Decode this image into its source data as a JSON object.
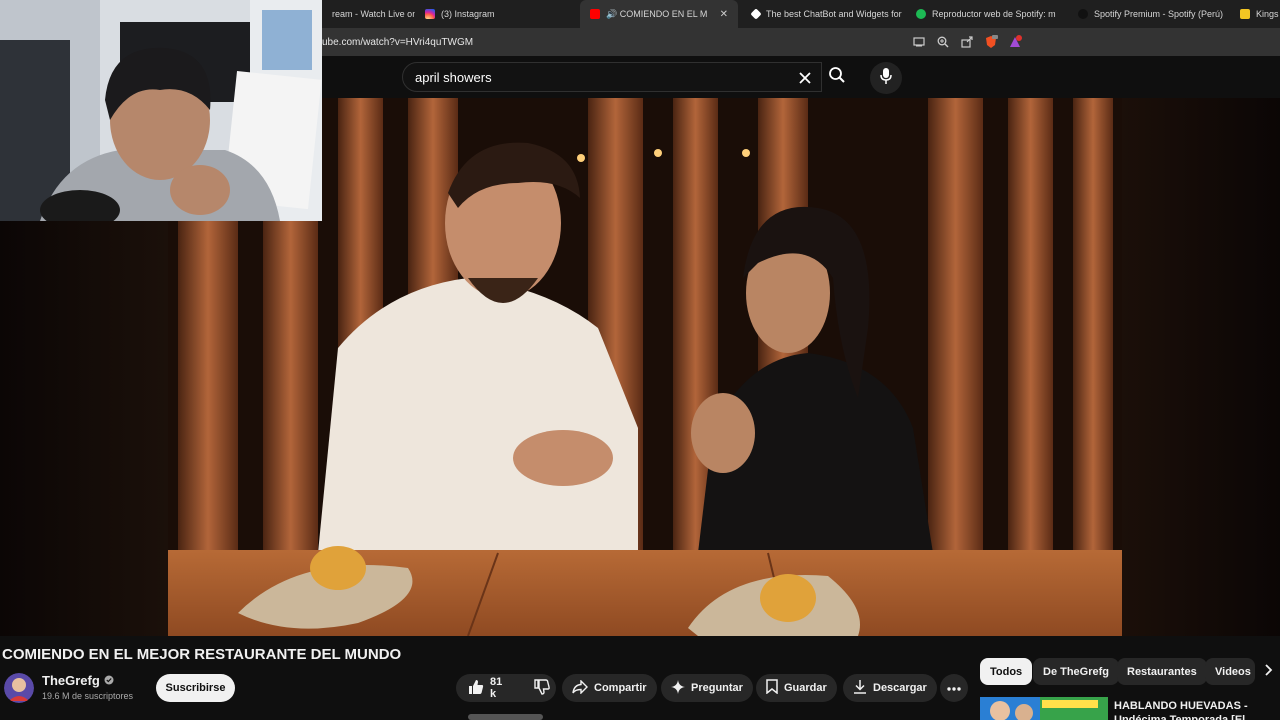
{
  "browser": {
    "tabs": [
      {
        "label": "ream - Watch Live on",
        "favicon_color": "#1f1f1f",
        "active": false
      },
      {
        "label": "(3) Instagram",
        "favicon_color": "#d62976",
        "active": false
      },
      {
        "label": "🔊 COMIENDO EN EL MEJOR R",
        "favicon_color": "#ff0000",
        "active": true
      },
      {
        "label": "The best ChatBot and Widgets for",
        "favicon_color": "#ffffff",
        "active": false
      },
      {
        "label": "Reproductor web de Spotify: músic",
        "favicon_color": "#1db954",
        "active": false
      },
      {
        "label": "Spotify Premium - Spotify (Perú)",
        "favicon_color": "#111111",
        "active": false
      },
      {
        "label": "Kings V",
        "favicon_color": "#f3c623",
        "active": false
      }
    ],
    "url": "ube.com/watch?v=HVri4quTWGM"
  },
  "search": {
    "query": "april showers"
  },
  "video": {
    "title": "COMIENDO EN EL MEJOR RESTAURANTE DEL MUNDO",
    "channel": "TheGrefg",
    "subscribers": "19.6 M de suscriptores",
    "subscribe_label": "Suscribirse",
    "likes": "81 k",
    "share_label": "Compartir",
    "ask_label": "Preguntar",
    "save_label": "Guardar",
    "download_label": "Descargar"
  },
  "chips": [
    "Todos",
    "De TheGrefg",
    "Restaurantes",
    "Videos"
  ],
  "recommendation": {
    "title": "HABLANDO HUEVADAS - Undécima Temporada [El"
  },
  "colors": {
    "accent": "#ff0000",
    "background": "#0f0f0f",
    "pill": "#272727"
  }
}
